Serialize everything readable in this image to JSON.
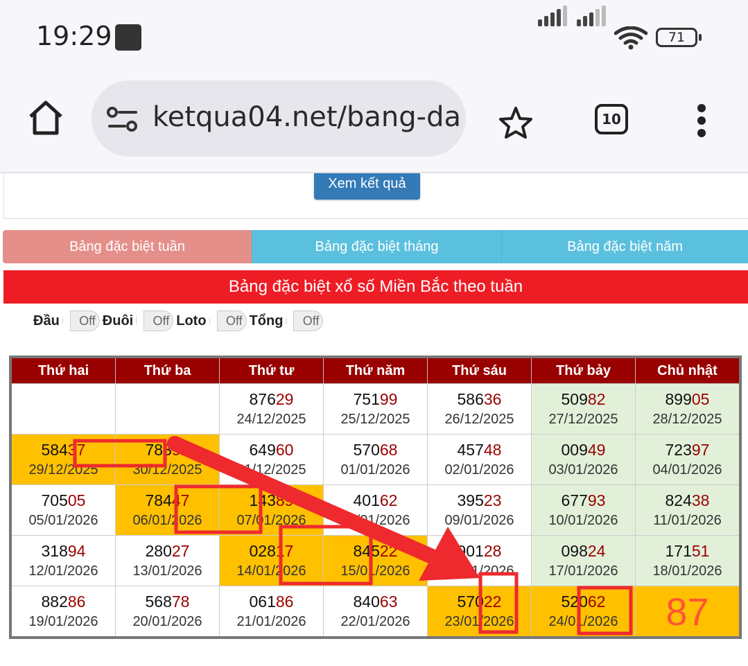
{
  "status": {
    "time": "19:29",
    "battery": "71"
  },
  "browser": {
    "url": "ketqua04.net/bang-da",
    "tab_count": "10"
  },
  "page": {
    "submit_button": "Xem kết quả",
    "tabs": [
      "Bảng đặc biệt tuần",
      "Bảng đặc biệt tháng",
      "Bảng đặc biệt năm"
    ],
    "title": "Bảng đặc biệt xổ số Miền Bắc theo tuần",
    "toggles": [
      {
        "label": "Đầu",
        "state": "Off"
      },
      {
        "label": "Đuôi",
        "state": "Off"
      },
      {
        "label": "Loto",
        "state": "Off"
      },
      {
        "label": "Tổng",
        "state": "Off"
      }
    ],
    "weekdays": [
      "Thứ hai",
      "Thứ ba",
      "Thứ tư",
      "Thứ năm",
      "Thứ sáu",
      "Thứ bảy",
      "Chủ nhật"
    ],
    "prediction": "87"
  },
  "table": {
    "rows": [
      [
        {
          "empty": true
        },
        {
          "empty": true
        },
        {
          "head": "876",
          "tail": "29",
          "date": "24/12/2025"
        },
        {
          "head": "751",
          "tail": "99",
          "date": "25/12/2025"
        },
        {
          "head": "586",
          "tail": "36",
          "date": "26/12/2025"
        },
        {
          "head": "509",
          "tail": "82",
          "date": "27/12/2025"
        },
        {
          "head": "899",
          "tail": "05",
          "date": "28/12/2025"
        }
      ],
      [
        {
          "head": "584",
          "tail": "37",
          "date": "29/12/2025",
          "hl": true
        },
        {
          "head": "783",
          "tail": "91",
          "date": "30/12/2025",
          "hl": true
        },
        {
          "head": "649",
          "tail": "60",
          "date": "31/12/2025"
        },
        {
          "head": "570",
          "tail": "68",
          "date": "01/01/2026"
        },
        {
          "head": "457",
          "tail": "48",
          "date": "02/01/2026"
        },
        {
          "head": "009",
          "tail": "49",
          "date": "03/01/2026"
        },
        {
          "head": "723",
          "tail": "97",
          "date": "04/01/2026"
        }
      ],
      [
        {
          "head": "705",
          "tail": "05",
          "date": "05/01/2026"
        },
        {
          "head": "784",
          "tail": "47",
          "date": "06/01/2026",
          "hl": true
        },
        {
          "head": "143",
          "tail": "89",
          "date": "07/01/2026",
          "hl": true
        },
        {
          "head": "401",
          "tail": "62",
          "date": "08/01/2026"
        },
        {
          "head": "395",
          "tail": "23",
          "date": "09/01/2026"
        },
        {
          "head": "677",
          "tail": "93",
          "date": "10/01/2026"
        },
        {
          "head": "824",
          "tail": "38",
          "date": "11/01/2026"
        }
      ],
      [
        {
          "head": "318",
          "tail": "94",
          "date": "12/01/2026"
        },
        {
          "head": "280",
          "tail": "27",
          "date": "13/01/2026"
        },
        {
          "head": "028",
          "tail": "17",
          "date": "14/01/2026",
          "hl": true
        },
        {
          "head": "845",
          "tail": "22",
          "date": "15/01/2026",
          "hl": true
        },
        {
          "head": "901",
          "tail": "28",
          "date": "16/01/2026"
        },
        {
          "head": "098",
          "tail": "24",
          "date": "17/01/2026"
        },
        {
          "head": "171",
          "tail": "51",
          "date": "18/01/2026"
        }
      ],
      [
        {
          "head": "882",
          "tail": "86",
          "date": "19/01/2026"
        },
        {
          "head": "568",
          "tail": "78",
          "date": "20/01/2026"
        },
        {
          "head": "061",
          "tail": "86",
          "date": "21/01/2026"
        },
        {
          "head": "840",
          "tail": "63",
          "date": "22/01/2026"
        },
        {
          "head": "570",
          "tail": "22",
          "date": "23/01/2026",
          "hl": true
        },
        {
          "head": "520",
          "tail": "62",
          "date": "24/01/2026",
          "hl": true
        },
        {
          "big": true,
          "hl": true
        }
      ]
    ]
  },
  "colors": {
    "annotation": "#ee2a2e",
    "highlight": "#ffc000",
    "weekend": "#e2f0d9",
    "header": "#990000"
  }
}
